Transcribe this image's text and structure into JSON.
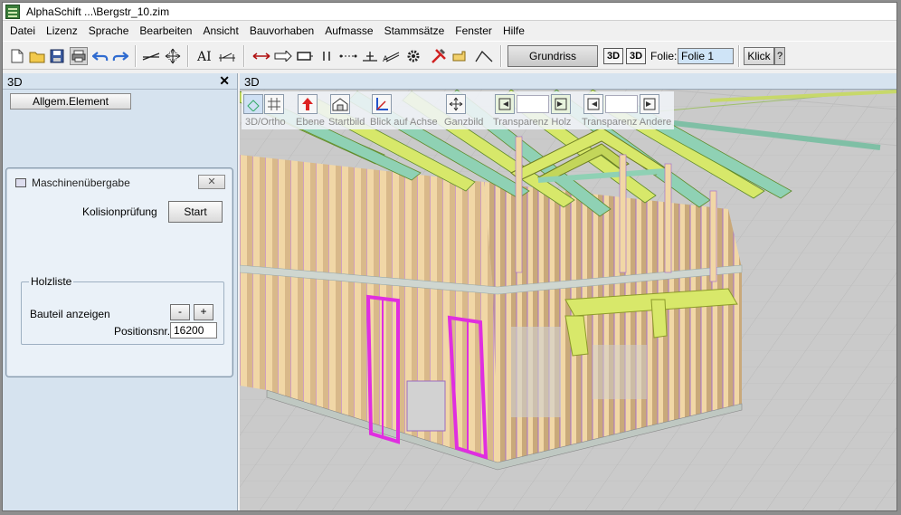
{
  "window": {
    "title": "AlphaSchift ...\\Bergstr_10.zim"
  },
  "menu": [
    "Datei",
    "Lizenz",
    "Sprache",
    "Bearbeiten",
    "Ansicht",
    "Bauvorhaben",
    "Aufmasse",
    "Stammsätze",
    "Fenster",
    "Hilfe"
  ],
  "toolbar": {
    "grundriss_label": "Grundriss",
    "view3d_label_1": "3D",
    "view3d_label_2": "3D",
    "folie_label": "Folie:",
    "folie_value": "Folie 1",
    "klick_label": "Klick",
    "help_label": "?"
  },
  "left_panel": {
    "title": "3D",
    "close_glyph": "✕",
    "allgem_button": "Allgem.Element"
  },
  "dialog": {
    "title": "Maschinenübergabe",
    "close_glyph": "✕",
    "kolisionpruefung_label": "Kolisionprüfung",
    "start_button": "Start",
    "holzliste": {
      "title": "Holzliste",
      "bauteil_label": "Bauteil anzeigen",
      "minus": "-",
      "plus": "+",
      "position_label": "Positionsnr.",
      "position_value": "16200"
    }
  },
  "view": {
    "title": "3D",
    "tools": [
      {
        "label": "3D/Ortho"
      },
      {
        "label": "Ebene"
      },
      {
        "label": "Startbild"
      },
      {
        "label": "Blick auf Achse"
      },
      {
        "label": "Ganzbild"
      },
      {
        "label": "Transparenz Holz"
      },
      {
        "label": "Transparenz Andere"
      }
    ]
  },
  "colors": {
    "panel_bg": "#d6e3ef",
    "timber": "#f3d9a8",
    "timber_edge": "#b05bd0",
    "highlight_magenta": "#e02ee0",
    "rafter_yellow": "#d8e86a",
    "beam_green": "#8fd1b4",
    "floor": "#c6c6c6"
  }
}
